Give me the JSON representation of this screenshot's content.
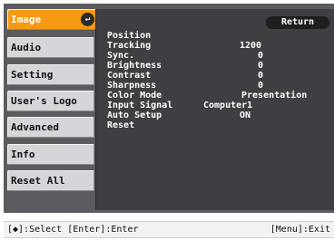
{
  "sidebar": {
    "items": [
      {
        "label": "Image"
      },
      {
        "label": "Audio"
      },
      {
        "label": "Setting"
      },
      {
        "label": "User's Logo"
      },
      {
        "label": "Advanced"
      },
      {
        "label": "Info"
      },
      {
        "label": "Reset All"
      }
    ],
    "enter_icon": "↵"
  },
  "submenu": {
    "return_label": "Return",
    "rows": [
      {
        "label": "Position",
        "value": ""
      },
      {
        "label": "Tracking",
        "value": "1200"
      },
      {
        "label": "Sync.",
        "value": "0"
      },
      {
        "label": "Brightness",
        "value": "0"
      },
      {
        "label": "Contrast",
        "value": "0"
      },
      {
        "label": "Sharpness",
        "value": "0"
      },
      {
        "label": "Color Mode",
        "value": "Presentation"
      },
      {
        "label": "Input Signal",
        "value": "Computer1"
      },
      {
        "label": "Auto Setup",
        "value": "ON"
      },
      {
        "label": "Reset",
        "value": ""
      }
    ]
  },
  "status": {
    "left": "[◆]:Select [Enter]:Enter",
    "right": "[Menu]:Exit"
  },
  "colors": {
    "active_tab": "#f59a12",
    "tab": "#d6d6da",
    "panel": "#3f3f43",
    "frame": "#5c5c60"
  }
}
